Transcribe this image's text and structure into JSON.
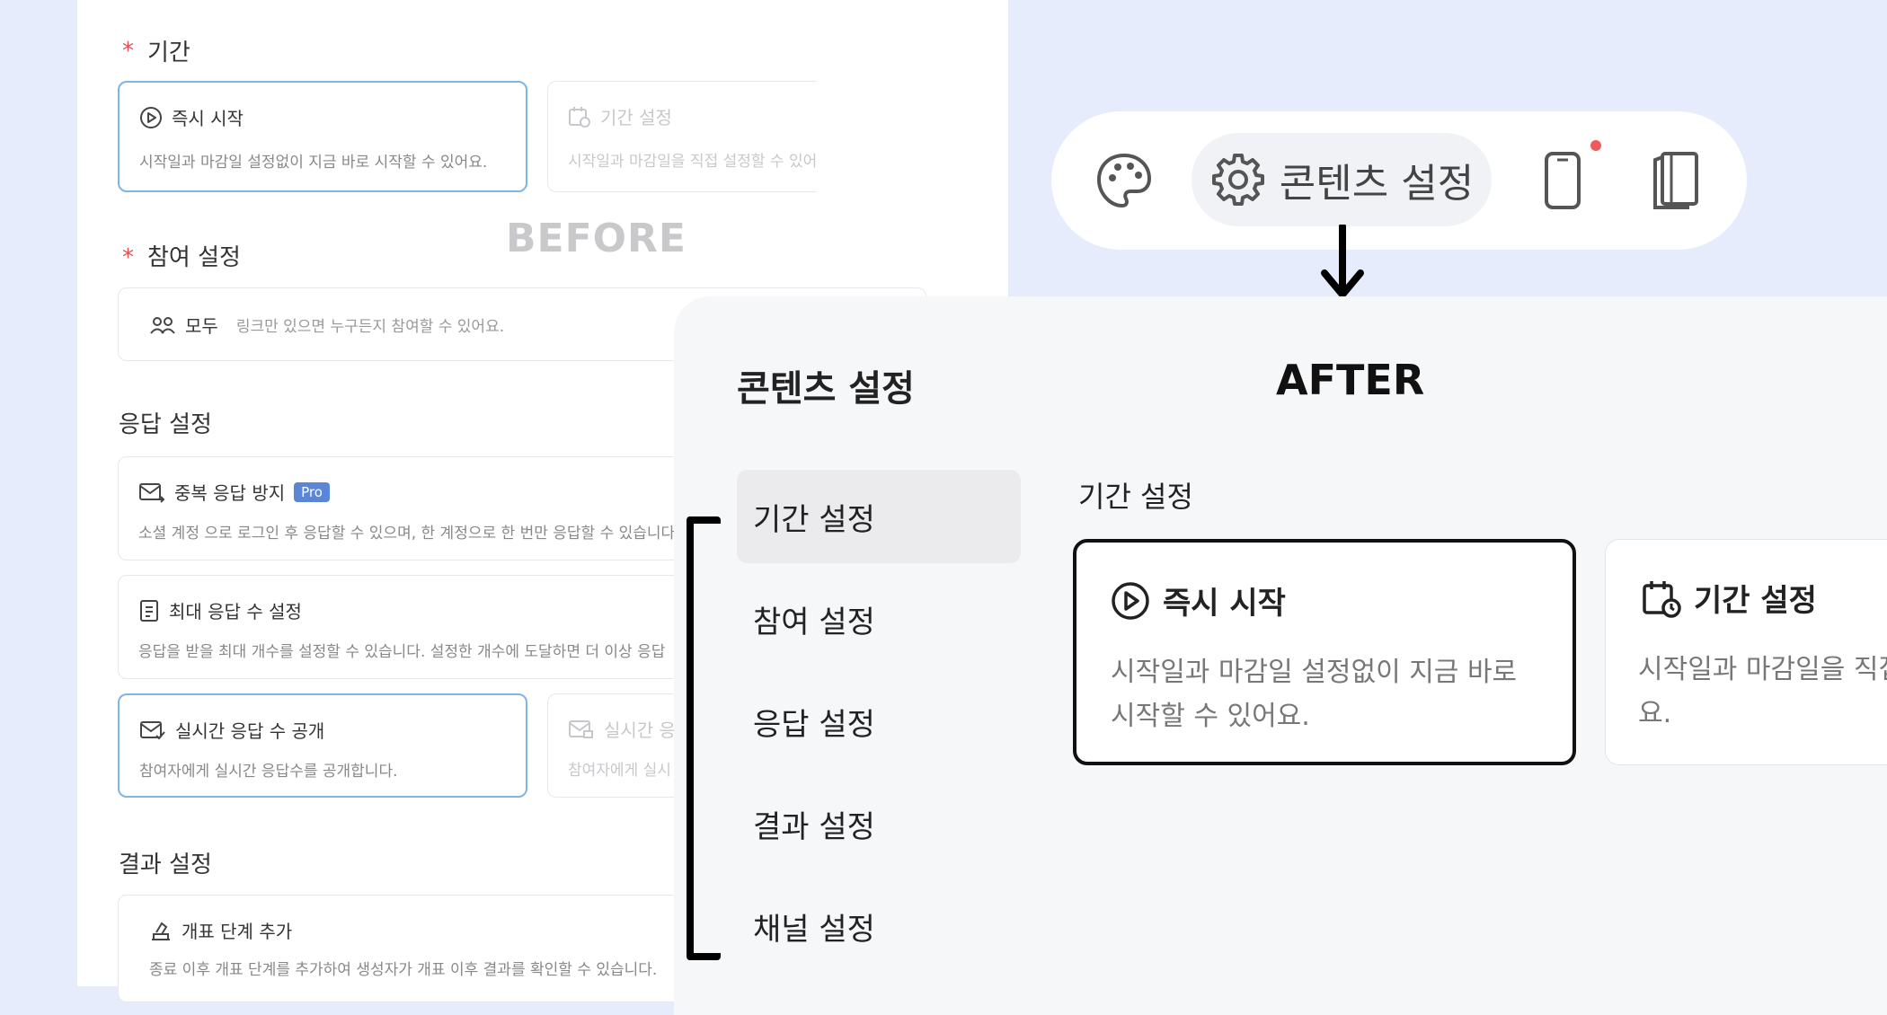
{
  "before": {
    "label": "BEFORE",
    "period": {
      "title": "기간",
      "required_mark": "*",
      "options": [
        {
          "title": "즉시 시작",
          "desc": "시작일과 마감일 설정없이 지금 바로 시작할 수 있어요."
        },
        {
          "title": "기간 설정",
          "desc": "시작일과 마감일을 직접 설정할 수 있어요."
        }
      ]
    },
    "participation": {
      "title": "참여 설정",
      "required_mark": "*",
      "option": {
        "title": "모두",
        "desc": "링크만 있으면 누구든지 참여할 수 있어요."
      }
    },
    "response": {
      "title": "응답 설정",
      "items": [
        {
          "title": "중복 응답 방지",
          "badge": "Pro",
          "desc": "소셜 계정 으로 로그인 후 응답할 수 있으며, 한 계정으로 한 번만 응답할 수 있습니다"
        },
        {
          "title": "최대 응답 수 설정",
          "desc": "응답을 받을 최대 개수를 설정할 수 있습니다. 설정한 개수에 도달하면 더 이상 응답"
        },
        {
          "title": "실시간 응답 수 공개",
          "desc": "참여자에게 실시간 응답수를 공개합니다."
        },
        {
          "title": "실시간 응답",
          "desc": "참여자에게 실시"
        }
      ]
    },
    "result": {
      "title": "결과 설정",
      "item": {
        "title": "개표 단계 추가",
        "desc": "종료 이후 개표 단계를 추가하여 생성자가 개표 이후 결과를 확인할 수 있습니다."
      }
    }
  },
  "toolbar": {
    "settings_label": "콘텐츠 설정",
    "icons": [
      "palette-icon",
      "gear-icon",
      "mobile-icon",
      "book-icon"
    ],
    "notification_color": "#f05a5a"
  },
  "after": {
    "label": "AFTER",
    "title": "콘텐츠 설정",
    "nav": [
      "기간 설정",
      "참여 설정",
      "응답 설정",
      "결과 설정",
      "채널 설정"
    ],
    "active_nav": "기간 설정",
    "section_title": "기간 설정",
    "options": [
      {
        "title": "즉시 시작",
        "desc": "시작일과 마감일 설정없이 지금 바로 시작할 수 있어요."
      },
      {
        "title": "기간 설정",
        "desc": "시작일과 마감일을 직접 설정할 수 있어요."
      }
    ]
  },
  "colors": {
    "accent_blue": "#7fb4e6",
    "pro_badge": "#5b86d6",
    "background": "#e6ecfb"
  }
}
